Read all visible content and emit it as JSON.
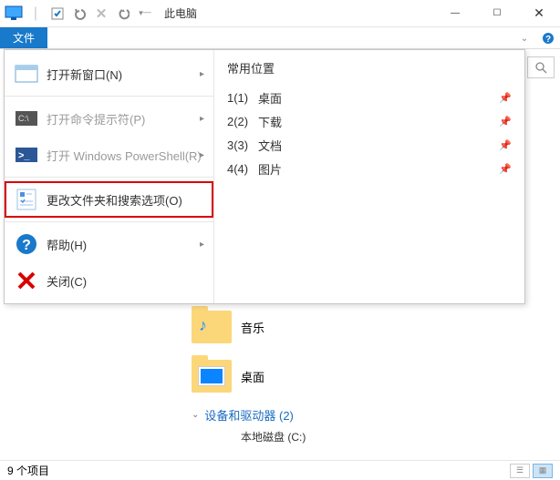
{
  "window": {
    "title": "此电脑",
    "minimize": "—",
    "maximize": "☐",
    "close": "✕"
  },
  "ribbon": {
    "file_tab": "文件"
  },
  "file_menu": {
    "items": [
      {
        "label": "打开新窗口(N)",
        "submenu": true
      },
      {
        "label": "打开命令提示符(P)",
        "submenu": true,
        "disabled": true
      },
      {
        "label": "打开 Windows PowerShell(R)",
        "submenu": true,
        "disabled": true
      },
      {
        "label": "更改文件夹和搜索选项(O)",
        "highlight": true
      },
      {
        "label": "帮助(H)",
        "submenu": true
      },
      {
        "label": "关闭(C)"
      }
    ],
    "frequent_title": "常用位置",
    "frequent": [
      {
        "num": "1(1)",
        "label": "桌面"
      },
      {
        "num": "2(2)",
        "label": "下载"
      },
      {
        "num": "3(3)",
        "label": "文档"
      },
      {
        "num": "4(4)",
        "label": "图片"
      }
    ]
  },
  "content": {
    "folders": [
      {
        "label": "音乐"
      },
      {
        "label": "桌面"
      }
    ],
    "group_heading": "设备和驱动器 (2)",
    "drive": "本地磁盘 (C:)"
  },
  "statusbar": {
    "items_text": "9 个项目"
  }
}
